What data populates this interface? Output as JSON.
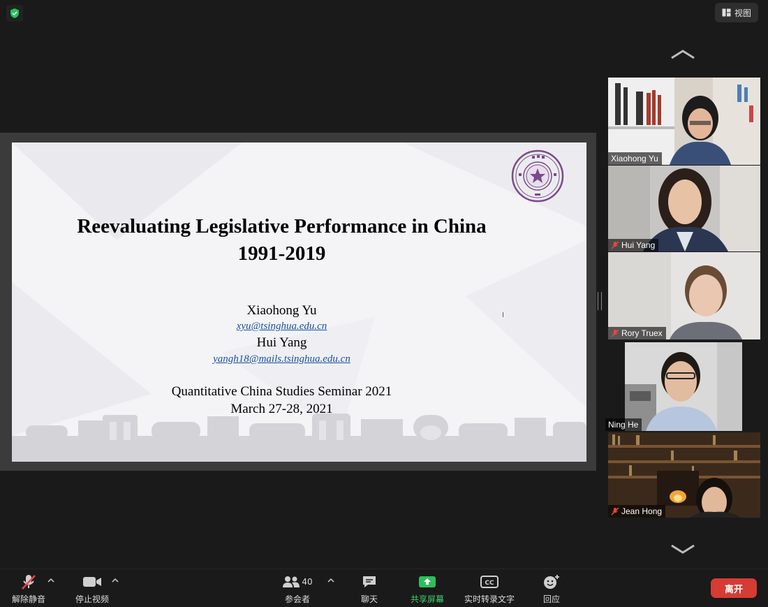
{
  "top": {
    "view_label": "视图"
  },
  "slide": {
    "title": "Reevaluating Legislative Performance in China",
    "years": "1991-2019",
    "author1": "Xiaohong Yu",
    "email1": "xyu@tsinghua.edu.cn",
    "author2": "Hui Yang",
    "email2": "yangh18@mails.tsinghua.edu.cn",
    "event": "Quantitative China Studies Seminar 2021",
    "date": "March 27-28, 2021",
    "cursor_glyph": "I"
  },
  "participants": [
    {
      "name": "Xiaohong Yu",
      "muted": false,
      "active": true
    },
    {
      "name": "Hui Yang",
      "muted": true,
      "active": false
    },
    {
      "name": "Rory Truex",
      "muted": true,
      "active": false
    },
    {
      "name": "Ning He",
      "muted": false,
      "active": false
    },
    {
      "name": "Jean Hong",
      "muted": true,
      "active": false
    }
  ],
  "toolbar": {
    "unmute": "解除静音",
    "stop_video": "停止视频",
    "participants": "参会者",
    "participant_count": "40",
    "chat": "聊天",
    "share": "共享屏幕",
    "captions": "实时转录文字",
    "captions_icon": "CC",
    "reactions": "回应",
    "leave": "离开"
  },
  "colors": {
    "share_green": "#3fcf6b",
    "leave_red": "#d63b34",
    "active_border": "#b8e05a"
  }
}
